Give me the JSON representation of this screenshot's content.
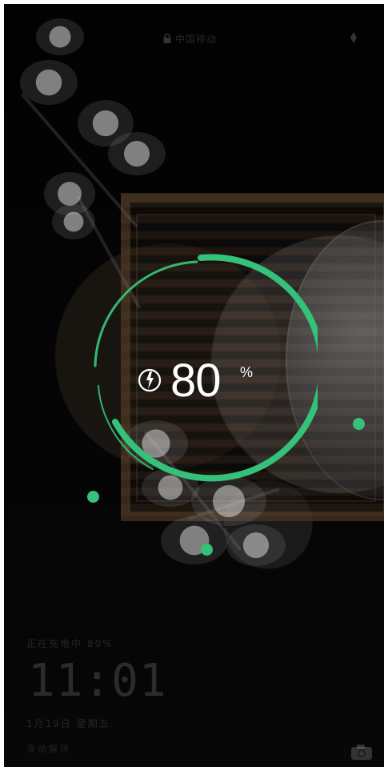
{
  "status_bar": {
    "carrier_text": "中国移动"
  },
  "charging": {
    "value": "80",
    "unit": "%",
    "level_percent": 80
  },
  "lock_screen": {
    "status_text": "正在充电中 80%",
    "time": "11:01",
    "date_text": "1月19日 星期五",
    "bottom_text": "滑动解锁"
  },
  "colors": {
    "accent_green": "#35c17a",
    "text_white": "#ffffff"
  },
  "icons": {
    "lock": "lock-icon",
    "battery_charge": "battery-charge-icon",
    "camera": "camera-icon"
  }
}
